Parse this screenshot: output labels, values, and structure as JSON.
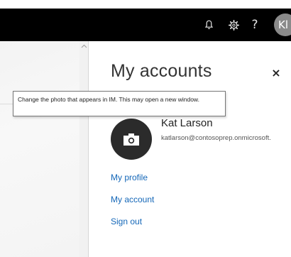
{
  "header": {
    "icons": [
      "bell-icon",
      "gear-icon",
      "help-icon"
    ],
    "help_glyph": "?",
    "avatar_initials": "Kl"
  },
  "panel": {
    "title": "My accounts",
    "close_glyph": "×",
    "user": {
      "name": "Kat Larson",
      "email": "katlarson@contosoprep.onmicrosoft."
    },
    "links": {
      "profile": "My profile",
      "account": "My account",
      "sign_out": "Sign out"
    }
  },
  "tooltip": {
    "text": "Change the photo that appears in IM. This may open a new window."
  },
  "colors": {
    "header_bg": "#000000",
    "link": "#1467b8",
    "avatar_bg": "#2b2b2b"
  }
}
